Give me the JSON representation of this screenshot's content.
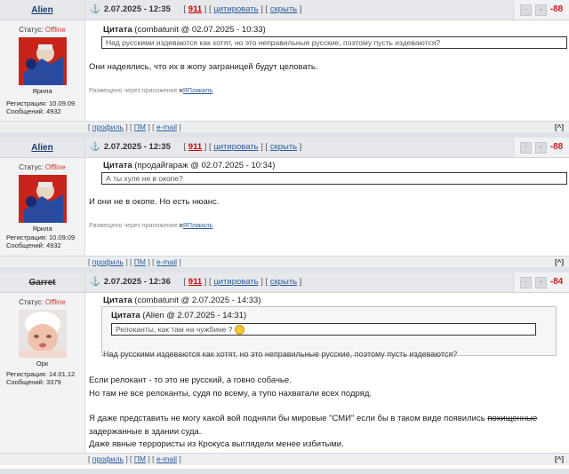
{
  "posts": [
    {
      "username": "Alien",
      "status_label": "Статус:",
      "status_value": "Offline",
      "avatar_caption": "Ярила",
      "reg_label": "Регистрация: 10.09.09",
      "msgs_label": "Сообщений: 4932",
      "datetime": "2.07.2025 - 12:35",
      "count": "911",
      "quote_link": "цитировать",
      "hide_link": "скрыть",
      "score": "-88",
      "quote": {
        "author": "Цитата",
        "meta": "(combatunit @ 02.07.2025 - 10:33)",
        "text": "Над русскими издеваются как хотят, но это неправильные русские, поэтому пусть издеваются?"
      },
      "body": [
        "Они надеялись, что их в жопу заграницей будут целовать."
      ],
      "via": "Размещено через приложение",
      "via_app": "ЯПлакалъ",
      "foot": {
        "profile": "профиль",
        "pm": "ПМ",
        "email": "e-mail"
      }
    },
    {
      "username": "Alien",
      "status_label": "Статус:",
      "status_value": "Offline",
      "avatar_caption": "Ярила",
      "reg_label": "Регистрация: 10.09.09",
      "msgs_label": "Сообщений: 4932",
      "datetime": "2.07.2025 - 12:35",
      "count": "911",
      "quote_link": "цитировать",
      "hide_link": "скрыть",
      "score": "-88",
      "quote": {
        "author": "Цитата",
        "meta": "(продайгараж @ 02.07.2025 - 10:34)",
        "text": "А ты хуле не в окопе?"
      },
      "body": [
        "И они не в окопе. Но есть нюанс."
      ],
      "via": "Размещено через приложение",
      "via_app": "ЯПлакалъ",
      "foot": {
        "profile": "профиль",
        "pm": "ПМ",
        "email": "e-mail"
      }
    },
    {
      "username": "Garret",
      "status_label": "Статус:",
      "status_value": "Offline",
      "avatar_caption": "Орк",
      "reg_label": "Регистрация: 14.01.12",
      "msgs_label": "Сообщений: 3379",
      "datetime": "2.07.2025 - 12:36",
      "count": "911",
      "quote_link": "цитировать",
      "hide_link": "скрыть",
      "score": "-84",
      "quote_outer": {
        "author": "Цитата",
        "meta": "(combatunit @ 2.07.2025 - 14:33)",
        "text": "Над русскими издеваются как хотят, но это неправильные русские, поэтому пусть издеваются?"
      },
      "quote_inner": {
        "author": "Цитата",
        "meta": "(Alien @ 2.07.2025 - 14:31)",
        "text": "Релоканты, как там на чужбине ?"
      },
      "body": [
        "Если релокант - то это не русский, а говно собачье.",
        "Но там не все релоканты, судя по всему, а тупо нахватали всех подряд.",
        "Я даже представить не могу какой вой подняли бы мировые \"СМИ\" если бы в таком виде появились",
        "похищенные",
        "задержанные в здании суда.",
        "Даже явные террористы из Крокуса выглядели менее избитыми."
      ],
      "foot": {
        "profile": "профиль",
        "pm": "ПМ",
        "email": "e-mail"
      }
    }
  ]
}
